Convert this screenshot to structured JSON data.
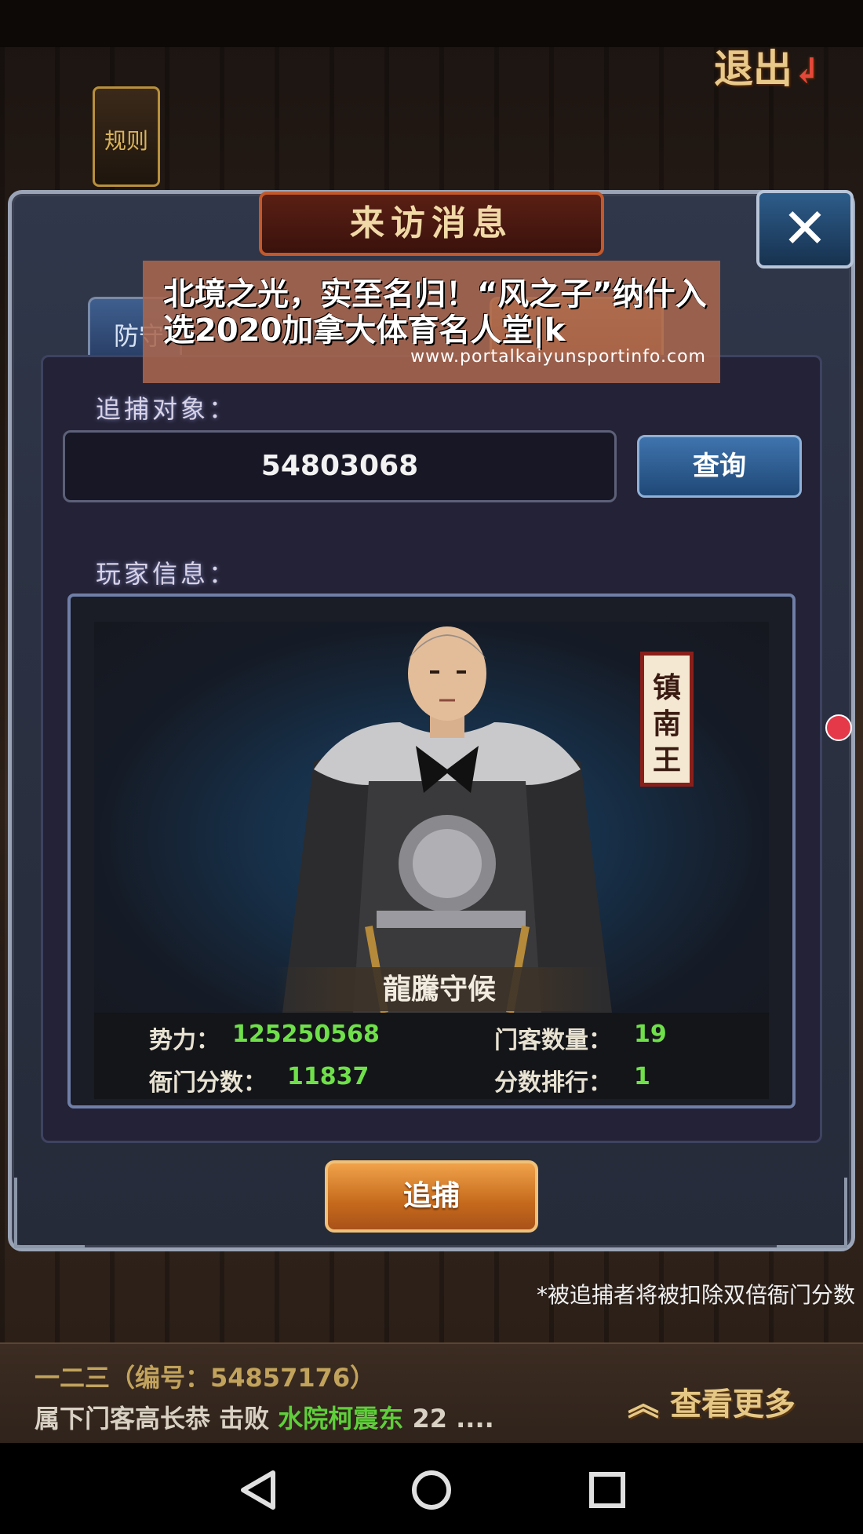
{
  "header": {
    "exit_label": "退出",
    "rules_label": "规则"
  },
  "dialog": {
    "title": "来访消息",
    "close_symbol": "✕",
    "tabs": [
      {
        "label": "防守"
      }
    ]
  },
  "search": {
    "section_label": "追捕对象：",
    "target_id": "54803068",
    "query_label": "查询"
  },
  "player": {
    "section_label": "玩家信息：",
    "title_tag": "镇南王",
    "honor": "龍騰守候",
    "stats": {
      "power_label": "势力：",
      "power_value": "125250568",
      "followers_label": "门客数量：",
      "followers_value": "19",
      "score_label": "衙门分数：",
      "score_value": "11837",
      "rank_label": "分数排行：",
      "rank_value": "1"
    }
  },
  "action": {
    "arrest_label": "追捕",
    "note": "*被追捕者将被扣除双倍衙门分数"
  },
  "news": {
    "line1": "一二三（编号：54857176）",
    "line2_prefix": "属下门客高长恭 击败 ",
    "line2_name": "水院柯震东",
    "line2_suffix": " 22 ....",
    "more_label": "查看更多"
  },
  "overlay": {
    "title": "北境之光，实至名归！“风之子”纳什入选2020加拿大体育名人堂|k",
    "url": "www.portalkaiyunsportinfo.com"
  },
  "colors": {
    "accent_green": "#6fe04a",
    "arrest_orange": "#c56a1c",
    "query_blue": "#1f4877"
  },
  "icons": [
    "close-icon",
    "back-triangle-icon",
    "home-circle-icon",
    "recents-square-icon",
    "double-chevron-up-icon"
  ]
}
